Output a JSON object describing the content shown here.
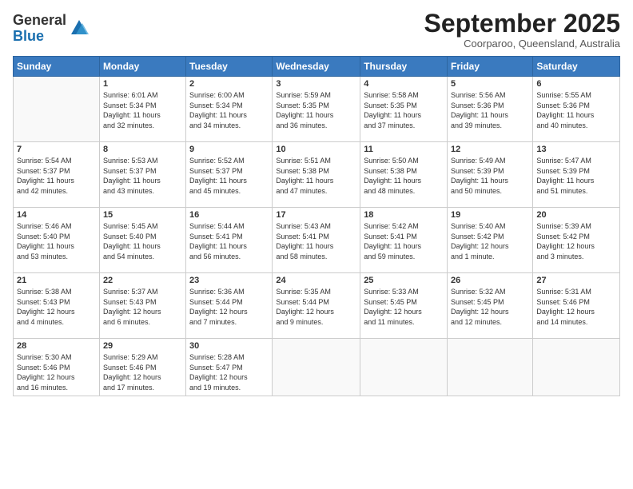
{
  "logo": {
    "general": "General",
    "blue": "Blue"
  },
  "title": "September 2025",
  "subtitle": "Coorparoo, Queensland, Australia",
  "days_of_week": [
    "Sunday",
    "Monday",
    "Tuesday",
    "Wednesday",
    "Thursday",
    "Friday",
    "Saturday"
  ],
  "weeks": [
    [
      {
        "day": "",
        "info": ""
      },
      {
        "day": "1",
        "info": "Sunrise: 6:01 AM\nSunset: 5:34 PM\nDaylight: 11 hours\nand 32 minutes."
      },
      {
        "day": "2",
        "info": "Sunrise: 6:00 AM\nSunset: 5:34 PM\nDaylight: 11 hours\nand 34 minutes."
      },
      {
        "day": "3",
        "info": "Sunrise: 5:59 AM\nSunset: 5:35 PM\nDaylight: 11 hours\nand 36 minutes."
      },
      {
        "day": "4",
        "info": "Sunrise: 5:58 AM\nSunset: 5:35 PM\nDaylight: 11 hours\nand 37 minutes."
      },
      {
        "day": "5",
        "info": "Sunrise: 5:56 AM\nSunset: 5:36 PM\nDaylight: 11 hours\nand 39 minutes."
      },
      {
        "day": "6",
        "info": "Sunrise: 5:55 AM\nSunset: 5:36 PM\nDaylight: 11 hours\nand 40 minutes."
      }
    ],
    [
      {
        "day": "7",
        "info": "Sunrise: 5:54 AM\nSunset: 5:37 PM\nDaylight: 11 hours\nand 42 minutes."
      },
      {
        "day": "8",
        "info": "Sunrise: 5:53 AM\nSunset: 5:37 PM\nDaylight: 11 hours\nand 43 minutes."
      },
      {
        "day": "9",
        "info": "Sunrise: 5:52 AM\nSunset: 5:37 PM\nDaylight: 11 hours\nand 45 minutes."
      },
      {
        "day": "10",
        "info": "Sunrise: 5:51 AM\nSunset: 5:38 PM\nDaylight: 11 hours\nand 47 minutes."
      },
      {
        "day": "11",
        "info": "Sunrise: 5:50 AM\nSunset: 5:38 PM\nDaylight: 11 hours\nand 48 minutes."
      },
      {
        "day": "12",
        "info": "Sunrise: 5:49 AM\nSunset: 5:39 PM\nDaylight: 11 hours\nand 50 minutes."
      },
      {
        "day": "13",
        "info": "Sunrise: 5:47 AM\nSunset: 5:39 PM\nDaylight: 11 hours\nand 51 minutes."
      }
    ],
    [
      {
        "day": "14",
        "info": "Sunrise: 5:46 AM\nSunset: 5:40 PM\nDaylight: 11 hours\nand 53 minutes."
      },
      {
        "day": "15",
        "info": "Sunrise: 5:45 AM\nSunset: 5:40 PM\nDaylight: 11 hours\nand 54 minutes."
      },
      {
        "day": "16",
        "info": "Sunrise: 5:44 AM\nSunset: 5:41 PM\nDaylight: 11 hours\nand 56 minutes."
      },
      {
        "day": "17",
        "info": "Sunrise: 5:43 AM\nSunset: 5:41 PM\nDaylight: 11 hours\nand 58 minutes."
      },
      {
        "day": "18",
        "info": "Sunrise: 5:42 AM\nSunset: 5:41 PM\nDaylight: 11 hours\nand 59 minutes."
      },
      {
        "day": "19",
        "info": "Sunrise: 5:40 AM\nSunset: 5:42 PM\nDaylight: 12 hours\nand 1 minute."
      },
      {
        "day": "20",
        "info": "Sunrise: 5:39 AM\nSunset: 5:42 PM\nDaylight: 12 hours\nand 3 minutes."
      }
    ],
    [
      {
        "day": "21",
        "info": "Sunrise: 5:38 AM\nSunset: 5:43 PM\nDaylight: 12 hours\nand 4 minutes."
      },
      {
        "day": "22",
        "info": "Sunrise: 5:37 AM\nSunset: 5:43 PM\nDaylight: 12 hours\nand 6 minutes."
      },
      {
        "day": "23",
        "info": "Sunrise: 5:36 AM\nSunset: 5:44 PM\nDaylight: 12 hours\nand 7 minutes."
      },
      {
        "day": "24",
        "info": "Sunrise: 5:35 AM\nSunset: 5:44 PM\nDaylight: 12 hours\nand 9 minutes."
      },
      {
        "day": "25",
        "info": "Sunrise: 5:33 AM\nSunset: 5:45 PM\nDaylight: 12 hours\nand 11 minutes."
      },
      {
        "day": "26",
        "info": "Sunrise: 5:32 AM\nSunset: 5:45 PM\nDaylight: 12 hours\nand 12 minutes."
      },
      {
        "day": "27",
        "info": "Sunrise: 5:31 AM\nSunset: 5:46 PM\nDaylight: 12 hours\nand 14 minutes."
      }
    ],
    [
      {
        "day": "28",
        "info": "Sunrise: 5:30 AM\nSunset: 5:46 PM\nDaylight: 12 hours\nand 16 minutes."
      },
      {
        "day": "29",
        "info": "Sunrise: 5:29 AM\nSunset: 5:46 PM\nDaylight: 12 hours\nand 17 minutes."
      },
      {
        "day": "30",
        "info": "Sunrise: 5:28 AM\nSunset: 5:47 PM\nDaylight: 12 hours\nand 19 minutes."
      },
      {
        "day": "",
        "info": ""
      },
      {
        "day": "",
        "info": ""
      },
      {
        "day": "",
        "info": ""
      },
      {
        "day": "",
        "info": ""
      }
    ]
  ]
}
